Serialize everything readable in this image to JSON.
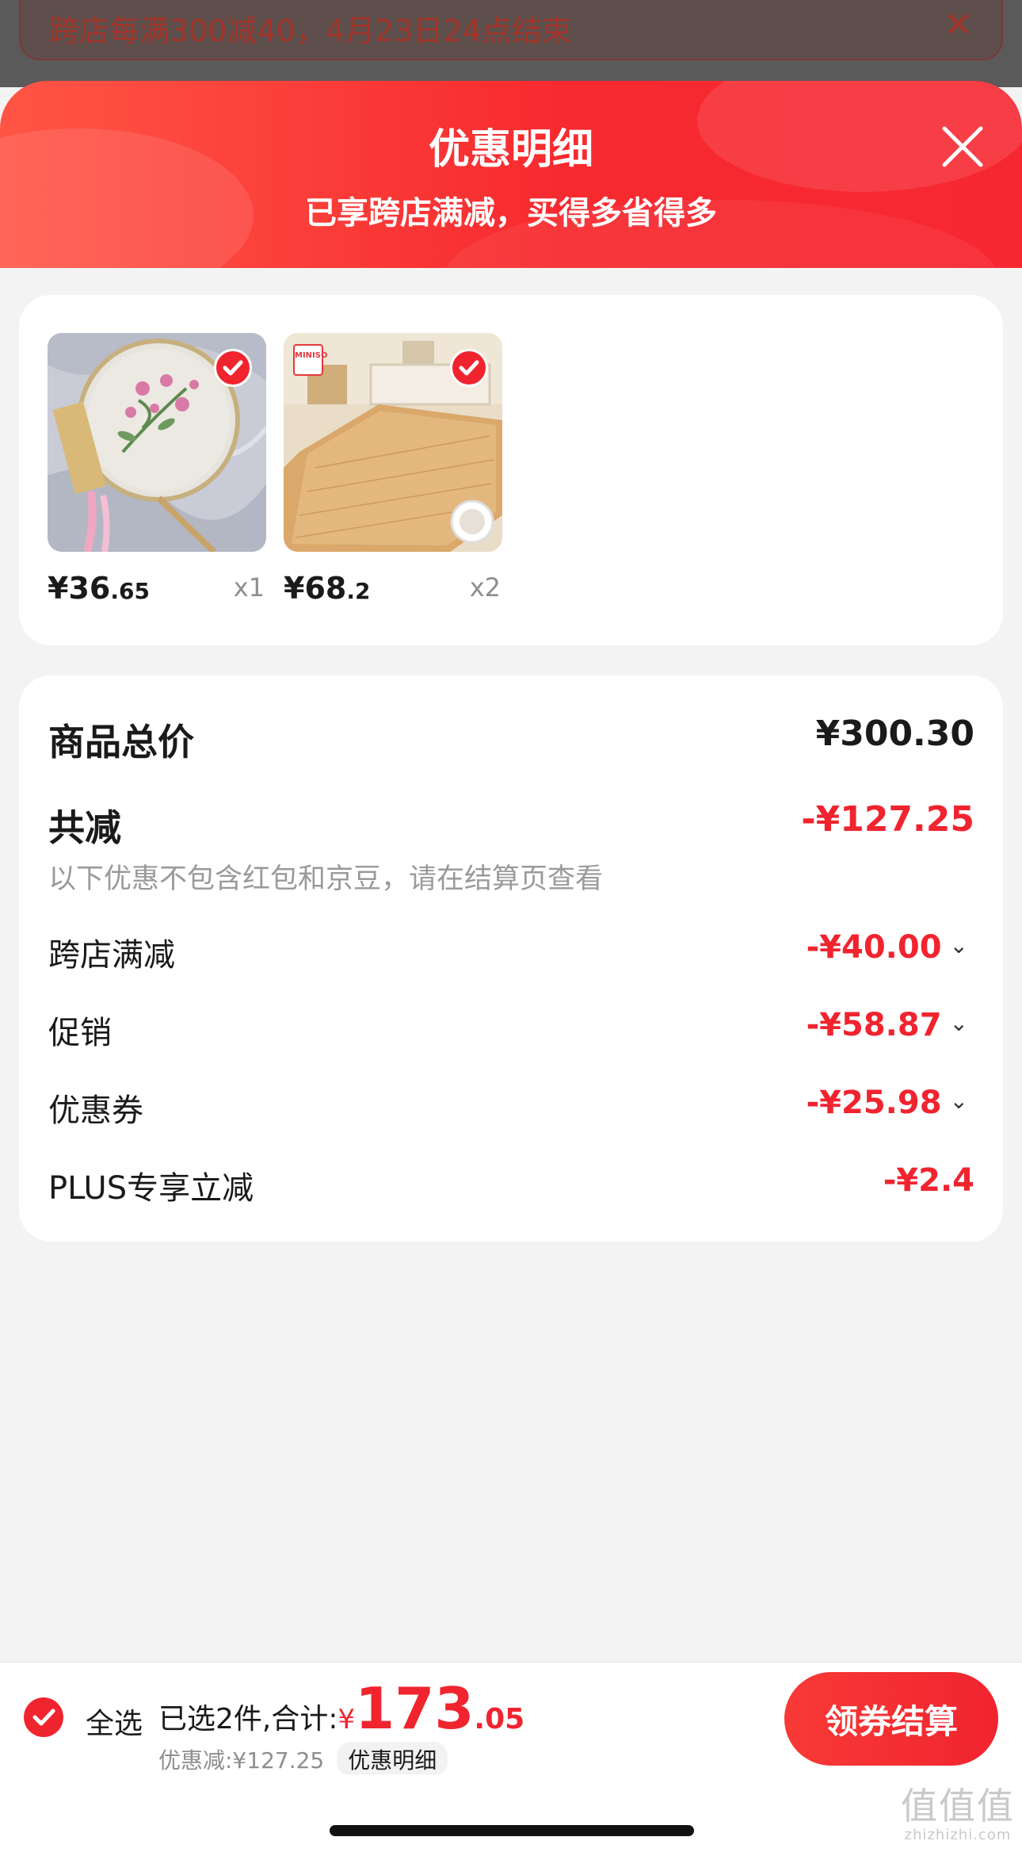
{
  "promo_banner": {
    "text": "跨店每满300减40，4月23日24点结束",
    "close_glyph": "✕"
  },
  "sheet": {
    "title": "优惠明细",
    "subtitle": "已享跨店满减，买得多省得多"
  },
  "products": [
    {
      "price_int": "¥36",
      "price_dec": ".65",
      "qty": "x1",
      "image": "embroidered-round-fan"
    },
    {
      "price_int": "¥68",
      "price_dec": ".2",
      "qty": "x2",
      "image": "rattan-floor-mat",
      "brand_badge": "MINISO"
    }
  ],
  "details": {
    "total_label": "商品总价",
    "total_value": "¥300.30",
    "reduce_label": "共减",
    "reduce_value": "-¥127.25",
    "note": "以下优惠不包含红包和京豆，请在结算页查看",
    "items": [
      {
        "label": "跨店满减",
        "value": "-¥40.00",
        "expandable": true
      },
      {
        "label": "促销",
        "value": "-¥58.87",
        "expandable": true
      },
      {
        "label": "优惠券",
        "value": "-¥25.98",
        "expandable": true
      },
      {
        "label": "PLUS专享立减",
        "value": "-¥2.4",
        "expandable": false
      }
    ],
    "chevron_glyph": "⌄"
  },
  "bottom": {
    "select_all": "全选",
    "summary_label": "已选2件,合计:",
    "yen": "¥",
    "total_int": "173",
    "total_dec": ".05",
    "discount_text": "优惠减:¥127.25",
    "discount_detail": "优惠明细",
    "checkout": "领券结算"
  },
  "watermark": {
    "big": "值值值",
    "small": "zhizhizhi.com"
  },
  "colors": {
    "accent": "#f0242f",
    "header_gradient_start": "#ff5545",
    "header_gradient_end": "#f72732",
    "muted_text": "#9a9a9a"
  }
}
